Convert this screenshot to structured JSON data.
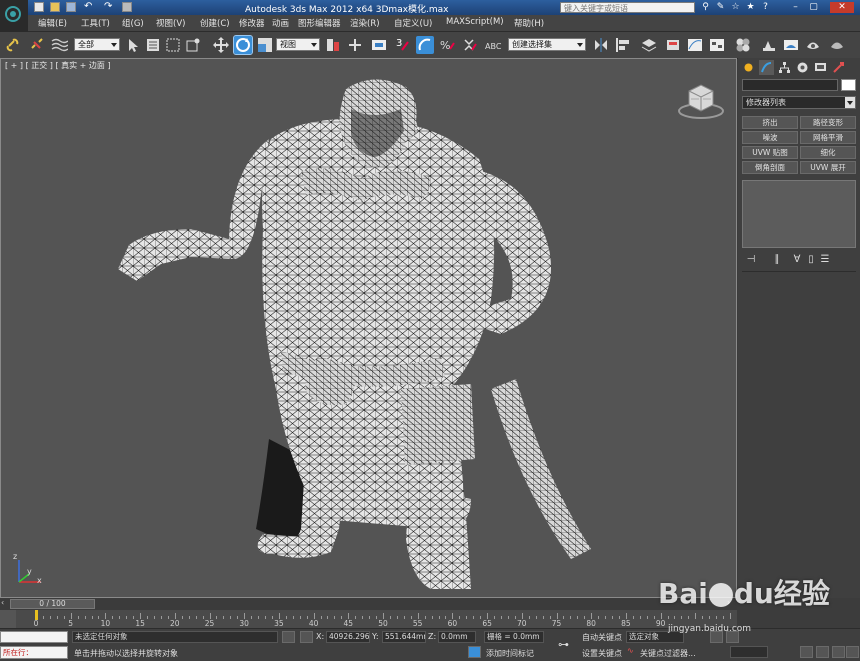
{
  "window": {
    "title": "Autodesk 3ds Max  2012 x64      3Dmax模化.max",
    "search_placeholder": "键入关键字或短语"
  },
  "menu": [
    "编辑(E)",
    "工具(T)",
    "组(G)",
    "视图(V)",
    "创建(C)",
    "修改器",
    "动画",
    "图形编辑器",
    "渲染(R)",
    "自定义(U)",
    "MAXScript(M)",
    "帮助(H)"
  ],
  "toolbar": {
    "selection_filter": "全部",
    "reference_coord": "视图",
    "snap_label": "3",
    "named_selection": "创建选择集"
  },
  "viewport": {
    "label": "[ + ] [ 正交 ] [ 真实 + 边面 ]",
    "axis_labels": {
      "x": "x",
      "y": "y",
      "z": "z"
    }
  },
  "command_panel": {
    "modifier_list": "修改器列表",
    "buttons": [
      "挤出",
      "路径变形",
      "噪波",
      "网格平滑",
      "UVW 贴图",
      "细化",
      "倒角剖面",
      "UVW 展开"
    ]
  },
  "timeline": {
    "frame_readout": "0 / 100",
    "current_frame": 0,
    "total_frames": 100,
    "ticks": [
      "0",
      "5",
      "10",
      "15",
      "20",
      "25",
      "30",
      "35",
      "40",
      "45",
      "50",
      "55",
      "60",
      "65",
      "70",
      "75",
      "80",
      "85",
      "90"
    ]
  },
  "status": {
    "listener_label": "所在行：",
    "selection_status": "未选定任何对象",
    "prompt": "单击并拖动以选择并旋转对象",
    "x_label": "X:",
    "x_value": "40926.296",
    "y_label": "Y:",
    "y_value": "551.644mm",
    "z_label": "Z:",
    "z_value": "0.0mm",
    "grid": "栅格 = 0.0mm",
    "add_time_tag": "添加时间标记",
    "auto_key": "自动关键点",
    "selected_object": "选定对象",
    "set_key": "设置关键点",
    "key_filters": "关键点过滤器..."
  },
  "watermark": {
    "brand": "Bai",
    "brand_mid": "du",
    "brand_cn": "经验",
    "url": "jingyan.baidu.com"
  },
  "colors": {
    "title_bar": "#2d5f9e",
    "viewport_bg": "#545454",
    "panel_bg": "#3f3f3f",
    "mesh_fill": "#e8e8e8",
    "active_tool": "#3a8fd8"
  }
}
